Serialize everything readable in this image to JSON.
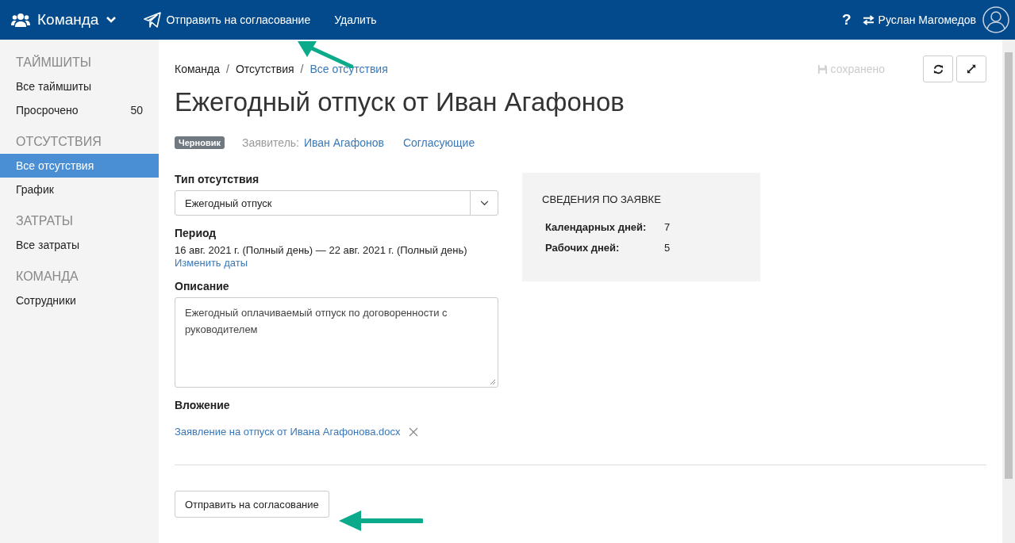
{
  "topbar": {
    "brand": "Команда",
    "actions": [
      "Отправить на согласование",
      "Удалить"
    ],
    "help": "?",
    "user": "Руслан Магомедов"
  },
  "sidebar": {
    "sections": [
      {
        "title": "ТАЙМШИТЫ",
        "items": [
          {
            "label": "Все таймшиты",
            "selected": false
          },
          {
            "label": "Просрочено",
            "count": "50",
            "selected": false
          }
        ]
      },
      {
        "title": "ОТСУТСТВИЯ",
        "items": [
          {
            "label": "Все отсутствия",
            "selected": true
          },
          {
            "label": "График",
            "selected": false
          }
        ]
      },
      {
        "title": "ЗАТРАТЫ",
        "items": [
          {
            "label": "Все затраты",
            "selected": false
          }
        ]
      },
      {
        "title": "КОМАНДА",
        "items": [
          {
            "label": "Сотрудники",
            "selected": false
          }
        ]
      }
    ]
  },
  "breadcrumb_separator": "/",
  "breadcrumbs": [
    {
      "label": "Команда",
      "kind": "plain"
    },
    {
      "label": "Отсутствия",
      "kind": "plain"
    },
    {
      "label": "Все отсутствия",
      "kind": "link"
    }
  ],
  "save_status": "сохранено",
  "title": "Ежегодный отпуск от Иван Агафонов",
  "status_badge": "Черновик",
  "applicant_label": "Заявитель:",
  "applicant": "Иван Агафонов",
  "approvers": "Согласующие",
  "form": {
    "absence_type": {
      "label": "Тип отсутствия",
      "value": "Ежегодный отпуск"
    },
    "period": {
      "label": "Период",
      "value": "16 авг. 2021 г. (Полный день) — 22 авг. 2021 г. (Полный день)",
      "change_link": "Изменить даты"
    },
    "description": {
      "label": "Описание",
      "value": "Ежегодный оплачиваемый отпуск по договоренности с руководителем"
    },
    "attachment": {
      "label": "Вложение",
      "file": "Заявление на отпуск от Ивана Агафонова.docx"
    }
  },
  "summary": {
    "title": "СВЕДЕНИЯ ПО ЗАЯВКЕ",
    "rows": [
      {
        "label": "Календарных дней:",
        "value": "7"
      },
      {
        "label": "Рабочих дней:",
        "value": "5"
      }
    ]
  },
  "submit_button": "Отправить на согласование"
}
